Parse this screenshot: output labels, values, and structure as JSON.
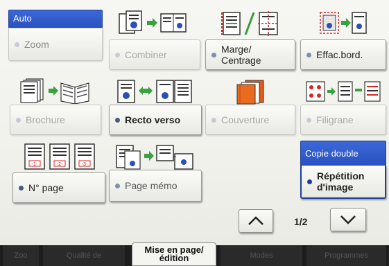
{
  "grid": {
    "auto_header": "Auto",
    "zoom": "Zoom",
    "combiner": "Combiner",
    "marge_line1": "Marge/",
    "marge_line2": "Centrage",
    "effac": "Effac.bord.",
    "brochure": "Brochure",
    "recto_verso": "Recto verso",
    "couverture": "Couverture",
    "filigrane": "Filigrane",
    "n_page": "N° page",
    "page_memo": "Page mémo",
    "copie_double_header": "Copie double",
    "repetition_line1": "Répétition",
    "repetition_line2": "d'image"
  },
  "icons": {
    "combiner": "combine-pages-icon",
    "marge": "margin-shift-icon",
    "effac": "frame-erase-icon",
    "brochure": "booklet-icon",
    "recto_verso": "duplex-icon",
    "couverture": "cover-icon",
    "filigrane": "watermark-icon",
    "n_page": "page-number-icon",
    "page_memo": "page-memo-icon"
  },
  "pager": {
    "text": "1/2"
  },
  "tabs": {
    "active_line1": "Mise en page/",
    "active_line2": "édition",
    "t1": "Zoo",
    "t2": "Qualité de",
    "t4": "Modes",
    "t5": "Programmes"
  },
  "colors": {
    "header_blue": "#2f58c8",
    "panel_bg": "#f3f3ef"
  }
}
